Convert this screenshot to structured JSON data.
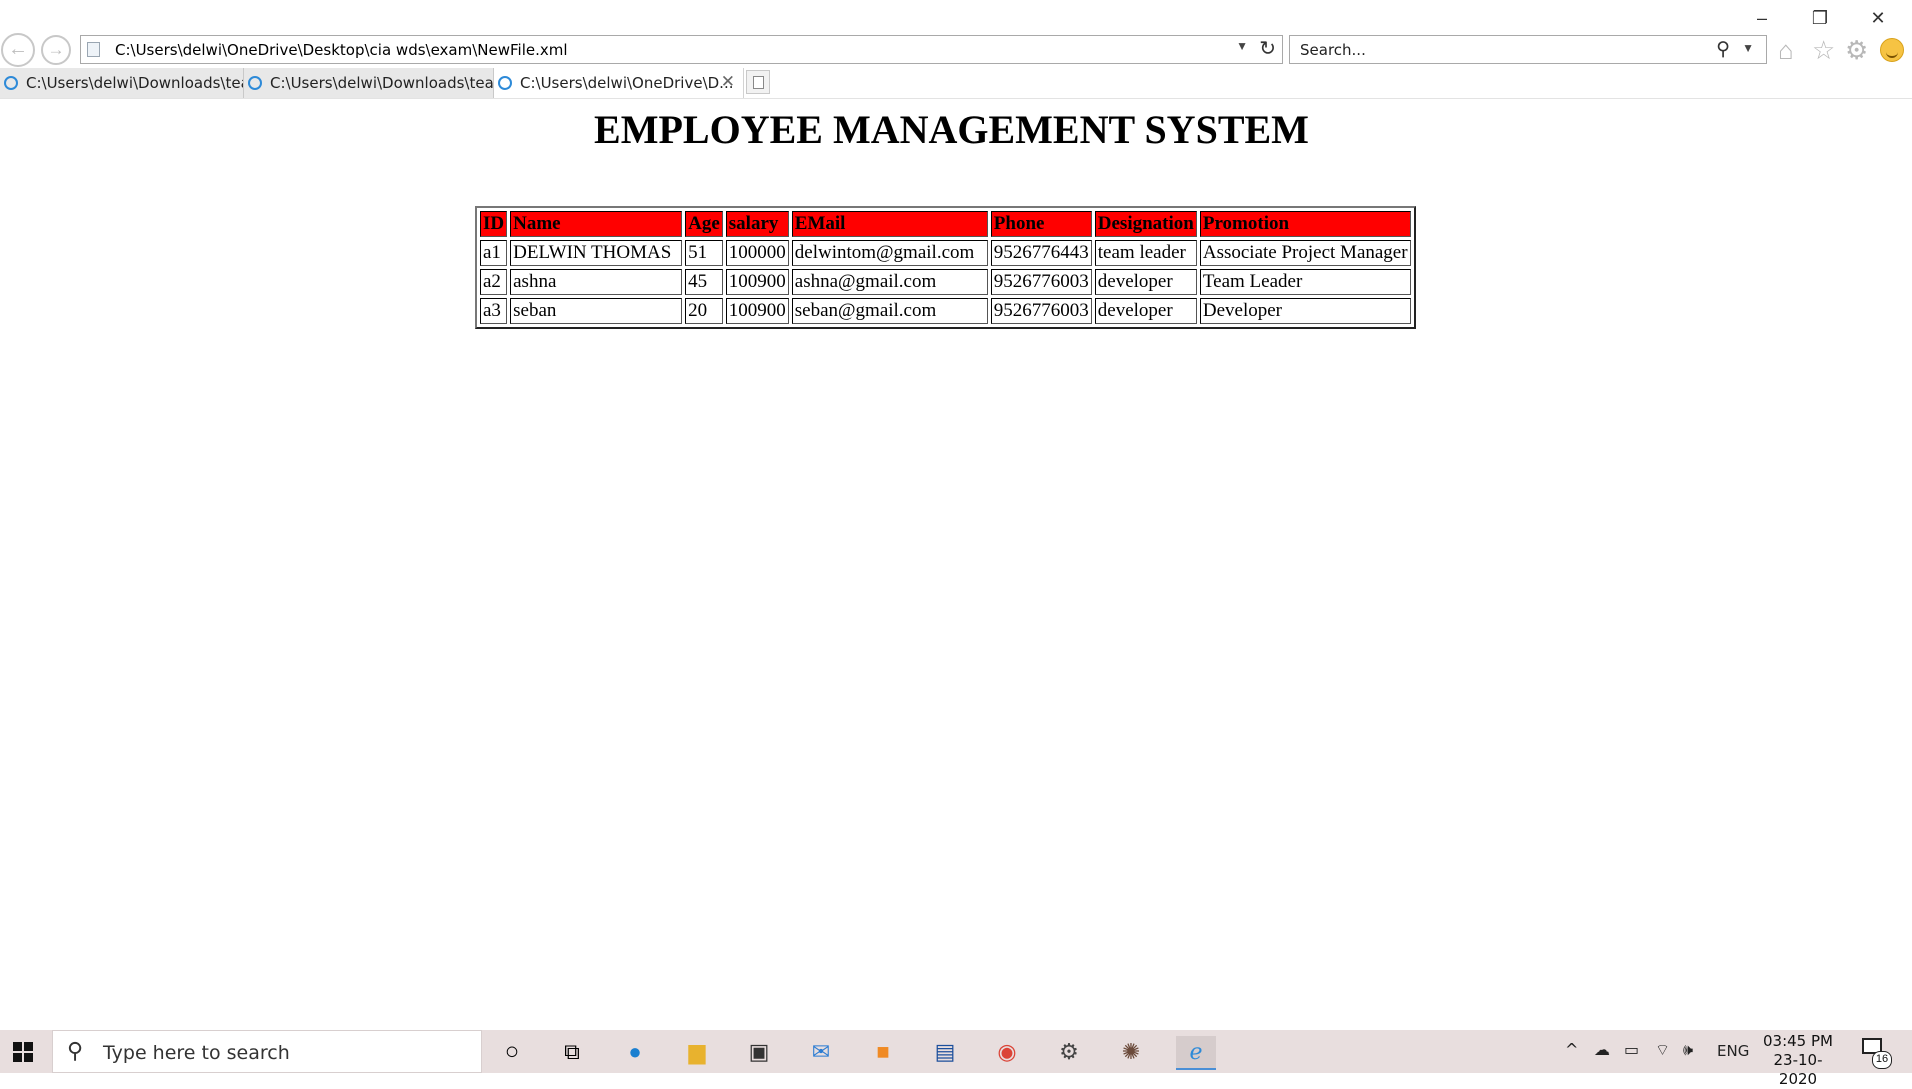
{
  "browser": {
    "url": "C:\\Users\\delwi\\OneDrive\\Desktop\\cia wds\\exam\\NewFile.xml",
    "search_placeholder": "Search...",
    "window_controls": {
      "minimize": "–",
      "restore": "❐",
      "close": "✕"
    },
    "tabs": [
      {
        "title": "C:\\Users\\delwi\\Downloads\\tea...",
        "active": false
      },
      {
        "title": "C:\\Users\\delwi\\Downloads\\tea...",
        "active": false
      },
      {
        "title": "C:\\Users\\delwi\\OneDrive\\D...",
        "active": true
      }
    ],
    "icons": [
      "back-icon",
      "forward-icon",
      "page-icon",
      "dropdown-icon",
      "refresh-icon",
      "search-icon",
      "home-icon",
      "favorites-star-icon",
      "settings-gear-icon",
      "feedback-smiley-icon"
    ]
  },
  "page": {
    "heading": "EMPLOYEE MANAGEMENT SYSTEM",
    "table": {
      "headers": [
        "ID",
        "Name",
        "Age",
        "salary",
        "EMail",
        "Phone",
        "Designation",
        "Promotion"
      ],
      "rows": [
        [
          "a1",
          "DELWIN THOMAS",
          "51",
          "100000",
          "delwintom@gmail.com",
          "9526776443",
          "team leader",
          "Associate Project Manager"
        ],
        [
          "a2",
          "ashna",
          "45",
          "100900",
          "ashna@gmail.com",
          "9526776003",
          "developer",
          "Team Leader"
        ],
        [
          "a3",
          "seban",
          "20",
          "100900",
          "seban@gmail.com",
          "9526776003",
          "developer",
          "Developer"
        ]
      ]
    },
    "colors": {
      "header_bg": "#ff0000"
    }
  },
  "taskbar": {
    "search_placeholder": "Type here to search",
    "apps": [
      "cortana-icon",
      "task-view-icon",
      "edge-icon",
      "file-explorer-icon",
      "store-icon",
      "mail-icon",
      "sublime-text-icon",
      "dev-cpp-icon",
      "chrome-icon",
      "settings-icon",
      "app-icon",
      "internet-explorer-icon"
    ],
    "tray": {
      "language": "ENG"
    },
    "clock": {
      "time": "03:45 PM",
      "date": "23-10-2020"
    },
    "notification_count": "16"
  }
}
